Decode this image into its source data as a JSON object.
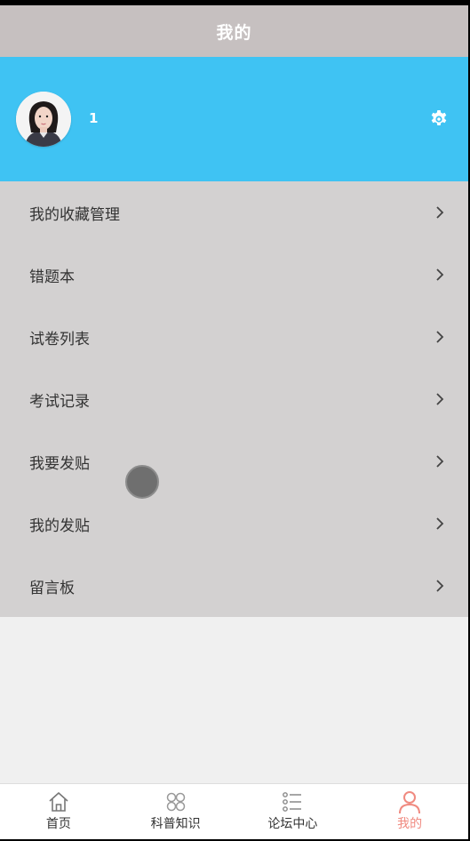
{
  "header": {
    "title": "我的"
  },
  "profile": {
    "username": "1"
  },
  "menu": {
    "items": [
      {
        "label": "我的收藏管理"
      },
      {
        "label": "错题本"
      },
      {
        "label": "试卷列表"
      },
      {
        "label": "考试记录"
      },
      {
        "label": "我要发贴"
      },
      {
        "label": "我的发贴"
      },
      {
        "label": "留言板"
      }
    ]
  },
  "tabbar": {
    "tabs": [
      {
        "label": "首页",
        "icon": "home-icon"
      },
      {
        "label": "科普知识",
        "icon": "grid-icon"
      },
      {
        "label": "论坛中心",
        "icon": "list-icon"
      },
      {
        "label": "我的",
        "icon": "user-icon",
        "active": true
      }
    ]
  },
  "colors": {
    "header_bg": "#c6c0c0",
    "profile_bg": "#3fc3f3",
    "menu_bg": "#d3d1d1",
    "active_tab": "#f08a80"
  }
}
